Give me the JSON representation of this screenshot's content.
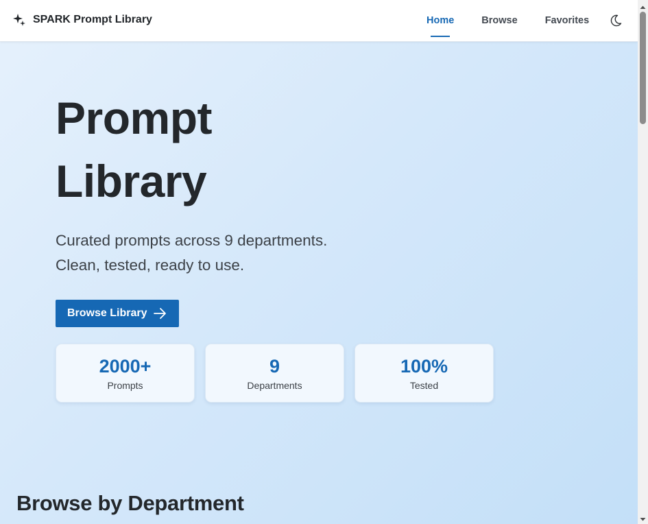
{
  "header": {
    "brand": "SPARK Prompt Library",
    "nav": [
      {
        "label": "Home",
        "active": true
      },
      {
        "label": "Browse",
        "active": false
      },
      {
        "label": "Favorites",
        "active": false
      }
    ],
    "theme_toggle_icon": "moon-icon",
    "brand_icon": "sparkles-icon"
  },
  "hero": {
    "title_line1": "Prompt",
    "title_line2": "Library",
    "subtitle_line1": "Curated prompts across 9 departments.",
    "subtitle_line2": "Clean, tested, ready to use.",
    "cta_label": "Browse Library",
    "cta_icon": "arrow-right-icon"
  },
  "stats": [
    {
      "value": "2000+",
      "label": "Prompts"
    },
    {
      "value": "9",
      "label": "Departments"
    },
    {
      "value": "100%",
      "label": "Tested"
    }
  ],
  "sections": {
    "departments_title": "Browse by Department"
  },
  "colors": {
    "accent": "#1668b4",
    "text": "#212529",
    "card_bg": "#f2f8fe"
  }
}
